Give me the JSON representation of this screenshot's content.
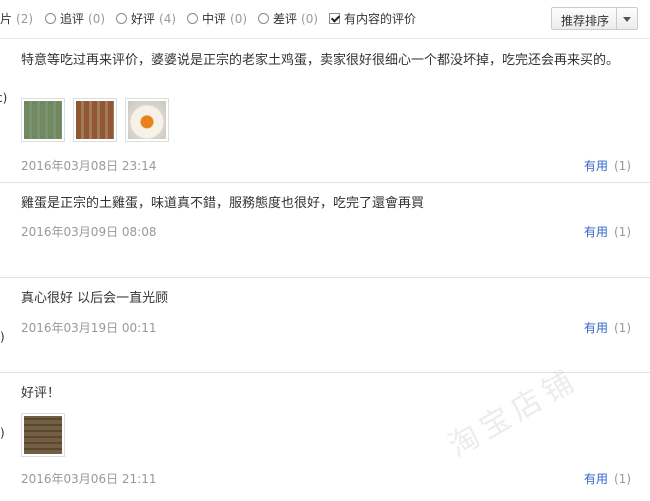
{
  "filters": [
    {
      "label": "图片",
      "count": "(2)",
      "type": "cut"
    },
    {
      "label": "追评",
      "count": "(0)",
      "type": "radio"
    },
    {
      "label": "好评",
      "count": "(4)",
      "type": "radio"
    },
    {
      "label": "中评",
      "count": "(0)",
      "type": "radio"
    },
    {
      "label": "差评",
      "count": "(0)",
      "type": "radio"
    },
    {
      "label": "有内容的评价",
      "count": "",
      "type": "checkbox",
      "checked": true
    }
  ],
  "sort": {
    "label": "推荐排序"
  },
  "reviews": [
    {
      "edge": "c)",
      "text": "特意等吃过再来评价，婆婆说是正宗的老家土鸡蛋，卖家很好很细心一个都没坏掉，吃完还会再来买的。",
      "images": [
        "eggs-tray-photo",
        "eggs-tray-photo",
        "cracked-egg-yolk-photo"
      ],
      "date": "2016年03月08日 23:14",
      "useful_label": "有用",
      "useful_count": "(1)"
    },
    {
      "edge": "",
      "text": "雞蛋是正宗的土雞蛋，味道真不錯，服務態度也很好，吃完了還會再買",
      "images": [],
      "date": "2016年03月09日 08:08",
      "useful_label": "有用",
      "useful_count": "(1)"
    },
    {
      "edge": ")",
      "text": "真心很好 以后会一直光顾",
      "images": [],
      "date": "2016年03月19日 00:11",
      "useful_label": "有用",
      "useful_count": "(1)"
    },
    {
      "edge": ")",
      "text": "好评！",
      "images": [
        "eggs-box-photo"
      ],
      "date": "2016年03月06日 21:11",
      "useful_label": "有用",
      "useful_count": "(1)"
    }
  ],
  "watermark": "淘宝店铺"
}
